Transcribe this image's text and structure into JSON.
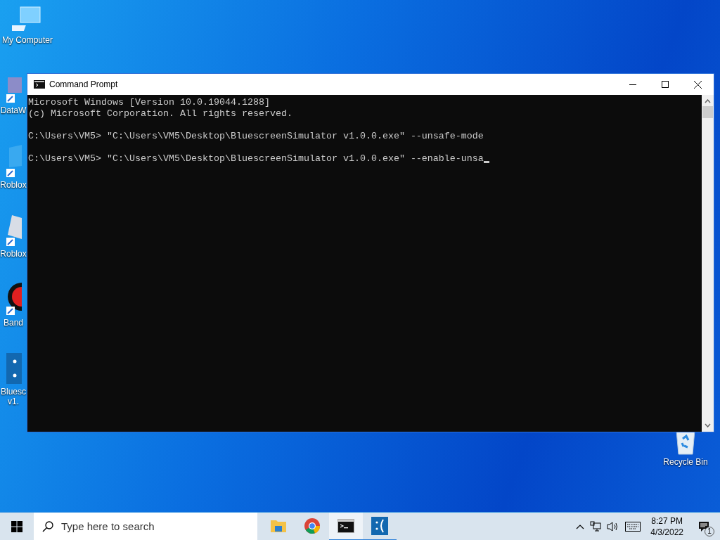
{
  "desktop_icons": [
    {
      "label": "My Computer",
      "kind": "computer"
    },
    {
      "label": "DataW",
      "kind": "grid"
    },
    {
      "label": "Roblox",
      "kind": "studio"
    },
    {
      "label": "Roblox",
      "kind": "roblox"
    },
    {
      "label": "Band",
      "kind": "record"
    },
    {
      "label": "Bluesc\nv1.",
      "kind": "bluescreen"
    },
    {
      "label": "Recycle Bin",
      "kind": "recycle"
    }
  ],
  "window": {
    "title": "Command Prompt",
    "blocks": [
      [
        "Microsoft Windows [Version 10.0.19044.1288]",
        "(c) Microsoft Corporation. All rights reserved."
      ],
      [
        "C:\\Users\\VM5> \"C:\\Users\\VM5\\Desktop\\BluescreenSimulator v1.0.0.exe\" --unsafe-mode"
      ],
      [
        "C:\\Users\\VM5> \"C:\\Users\\VM5\\Desktop\\BluescreenSimulator v1.0.0.exe\" --enable-unsa"
      ]
    ],
    "cursor": true
  },
  "taskbar": {
    "search": {
      "placeholder": "Type here to search"
    },
    "apps": [
      {
        "kind": "folder",
        "selected": false,
        "running": false
      },
      {
        "kind": "chrome",
        "selected": false,
        "running": false
      },
      {
        "kind": "console",
        "selected": true,
        "running": true
      },
      {
        "kind": "sad",
        "selected": false,
        "running": true
      }
    ],
    "time": "8:27 PM",
    "date": "4/3/2022",
    "notifications": "1"
  }
}
